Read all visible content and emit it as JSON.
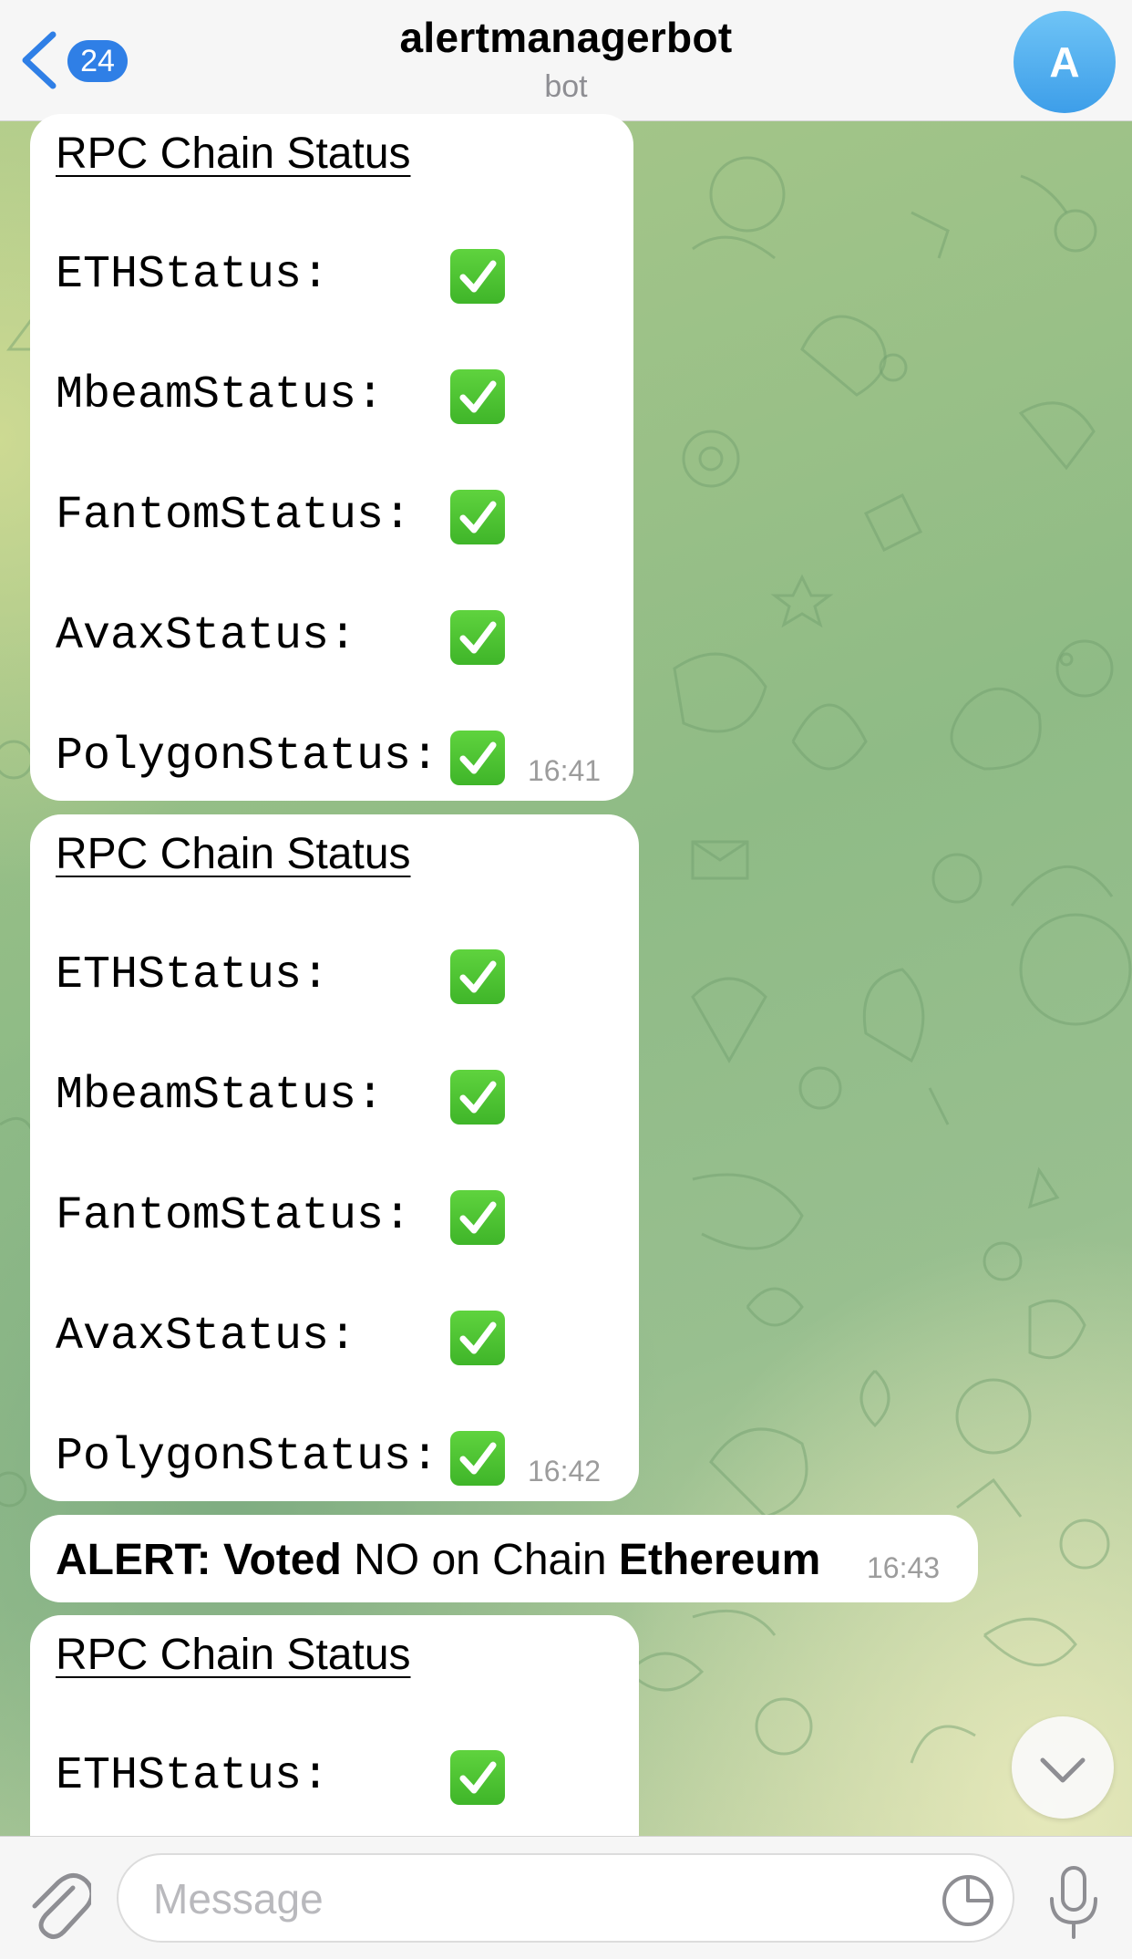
{
  "header": {
    "back_badge": "24",
    "title": "alertmanagerbot",
    "subtitle": "bot",
    "avatar_letter": "A"
  },
  "messages": [
    {
      "title": "RPC Chain Status",
      "lines": [
        "ETHStatus:",
        "MbeamStatus:",
        "FantomStatus:",
        "AvaxStatus:",
        "PolygonStatus:"
      ],
      "status_icon": "check-mark-button-icon",
      "time": "16:41"
    },
    {
      "title": "RPC Chain Status",
      "lines": [
        "ETHStatus:",
        "MbeamStatus:",
        "FantomStatus:",
        "AvaxStatus:",
        "PolygonStatus:"
      ],
      "status_icon": "check-mark-button-icon",
      "time": "16:42"
    },
    {
      "alert_prefix": "ALERT: Voted",
      "alert_middle": " NO on Chain ",
      "alert_chain": "Ethereum",
      "time": "16:43"
    },
    {
      "title": "RPC Chain Status",
      "lines": [
        "ETHStatus:"
      ],
      "status_icon": "check-mark-button-icon"
    }
  ],
  "composer": {
    "placeholder": "Message"
  },
  "colors": {
    "accent": "#2f7fe6",
    "check_green": "#4cc232",
    "bubble": "#ffffff"
  }
}
